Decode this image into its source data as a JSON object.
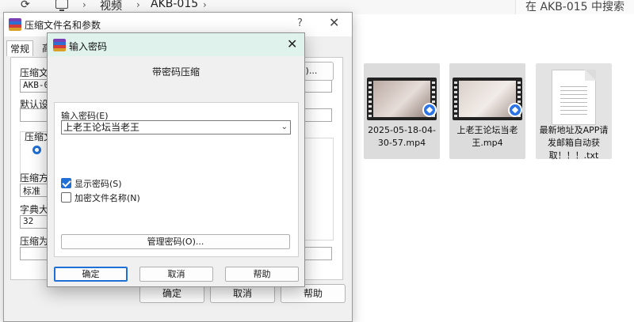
{
  "explorer": {
    "refresh_icon": "refresh-icon",
    "pc_icon": "computer-icon",
    "breadcrumb": [
      "视频",
      "AKB-015"
    ],
    "search_placeholder": "在 AKB-015 中搜索",
    "files": [
      {
        "name": "2025-05-18-04-30-57.mp4",
        "type": "video"
      },
      {
        "name": "上老王论坛当老王.mp4",
        "type": "video"
      },
      {
        "name": "最新地址及APP请发邮箱自动获取！！！.txt",
        "type": "text"
      }
    ]
  },
  "back_dialog": {
    "title": "压缩文件名和参数",
    "help_icon": "question-icon",
    "close_icon": "close-icon",
    "tabs": [
      "常规",
      "高"
    ],
    "labels": {
      "archive_name": "压缩文",
      "archive_name_value": "AKB-01",
      "browse": "B)...",
      "default": "默认设",
      "format_group": "压缩文",
      "method": "压缩方",
      "method_value": "标准",
      "dict": "字典大",
      "dict_value": "32",
      "split": "压缩为"
    },
    "buttons": {
      "ok": "确定",
      "cancel": "取消",
      "help": "帮助"
    }
  },
  "front_dialog": {
    "title": "输入密码",
    "subtitle": "带密码压缩",
    "password_label": "输入密码(E)",
    "password_value": "上老王论坛当老王",
    "show_password_label": "显示密码(S)",
    "show_password_checked": true,
    "encrypt_names_label": "加密文件名称(N)",
    "encrypt_names_checked": false,
    "manage_button": "管理密码(O)...",
    "buttons": {
      "ok": "确定",
      "cancel": "取消",
      "help": "帮助"
    }
  }
}
